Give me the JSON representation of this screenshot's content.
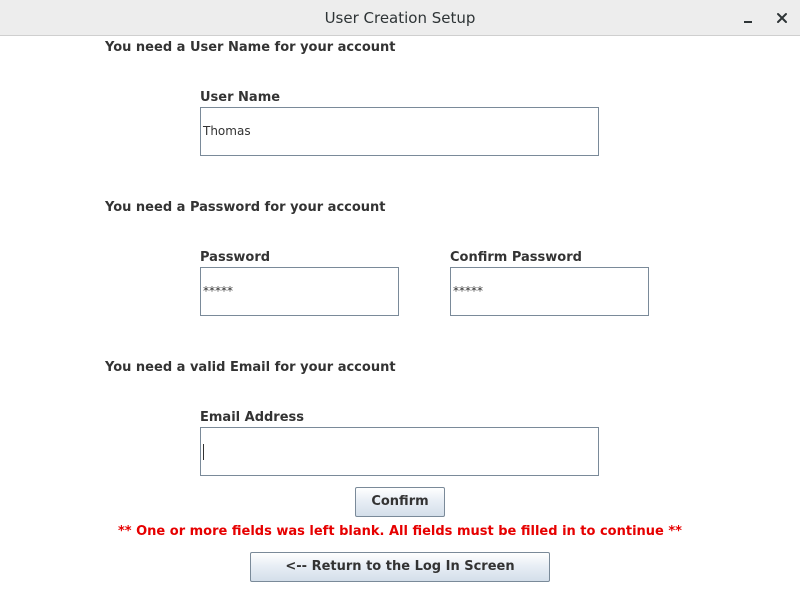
{
  "window": {
    "title": "User Creation Setup",
    "minimize_glyph": "‗",
    "close_glyph": "✕"
  },
  "sections": {
    "username_prompt": "You need a User Name for your account",
    "password_prompt": "You need a Password for your account",
    "email_prompt": "You need a valid Email for your account"
  },
  "fields": {
    "username": {
      "label": "User Name",
      "value": "Thomas"
    },
    "password": {
      "label": "Password",
      "value": "*****"
    },
    "confirm_password": {
      "label": "Confirm Password",
      "value": "*****"
    },
    "email": {
      "label": "Email Address",
      "value": ""
    }
  },
  "buttons": {
    "confirm": "Confirm",
    "return": "<-- Return to the Log In Screen"
  },
  "error_message": "** One or more fields was left blank. All fields must be filled in to continue **",
  "colors": {
    "error": "#e60000",
    "field_border": "#7a8a99",
    "titlebar": "#ededed"
  }
}
